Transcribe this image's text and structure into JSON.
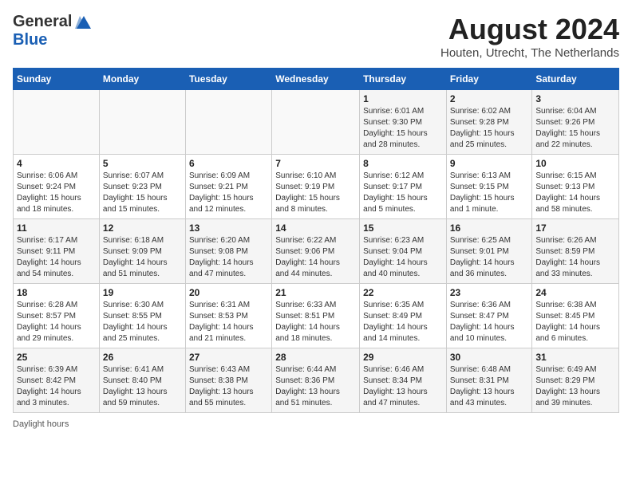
{
  "header": {
    "logo_general": "General",
    "logo_blue": "Blue",
    "month_year": "August 2024",
    "location": "Houten, Utrecht, The Netherlands"
  },
  "days_of_week": [
    "Sunday",
    "Monday",
    "Tuesday",
    "Wednesday",
    "Thursday",
    "Friday",
    "Saturday"
  ],
  "weeks": [
    [
      {
        "day": "",
        "info": ""
      },
      {
        "day": "",
        "info": ""
      },
      {
        "day": "",
        "info": ""
      },
      {
        "day": "",
        "info": ""
      },
      {
        "day": "1",
        "info": "Sunrise: 6:01 AM\nSunset: 9:30 PM\nDaylight: 15 hours\nand 28 minutes."
      },
      {
        "day": "2",
        "info": "Sunrise: 6:02 AM\nSunset: 9:28 PM\nDaylight: 15 hours\nand 25 minutes."
      },
      {
        "day": "3",
        "info": "Sunrise: 6:04 AM\nSunset: 9:26 PM\nDaylight: 15 hours\nand 22 minutes."
      }
    ],
    [
      {
        "day": "4",
        "info": "Sunrise: 6:06 AM\nSunset: 9:24 PM\nDaylight: 15 hours\nand 18 minutes."
      },
      {
        "day": "5",
        "info": "Sunrise: 6:07 AM\nSunset: 9:23 PM\nDaylight: 15 hours\nand 15 minutes."
      },
      {
        "day": "6",
        "info": "Sunrise: 6:09 AM\nSunset: 9:21 PM\nDaylight: 15 hours\nand 12 minutes."
      },
      {
        "day": "7",
        "info": "Sunrise: 6:10 AM\nSunset: 9:19 PM\nDaylight: 15 hours\nand 8 minutes."
      },
      {
        "day": "8",
        "info": "Sunrise: 6:12 AM\nSunset: 9:17 PM\nDaylight: 15 hours\nand 5 minutes."
      },
      {
        "day": "9",
        "info": "Sunrise: 6:13 AM\nSunset: 9:15 PM\nDaylight: 15 hours\nand 1 minute."
      },
      {
        "day": "10",
        "info": "Sunrise: 6:15 AM\nSunset: 9:13 PM\nDaylight: 14 hours\nand 58 minutes."
      }
    ],
    [
      {
        "day": "11",
        "info": "Sunrise: 6:17 AM\nSunset: 9:11 PM\nDaylight: 14 hours\nand 54 minutes."
      },
      {
        "day": "12",
        "info": "Sunrise: 6:18 AM\nSunset: 9:09 PM\nDaylight: 14 hours\nand 51 minutes."
      },
      {
        "day": "13",
        "info": "Sunrise: 6:20 AM\nSunset: 9:08 PM\nDaylight: 14 hours\nand 47 minutes."
      },
      {
        "day": "14",
        "info": "Sunrise: 6:22 AM\nSunset: 9:06 PM\nDaylight: 14 hours\nand 44 minutes."
      },
      {
        "day": "15",
        "info": "Sunrise: 6:23 AM\nSunset: 9:04 PM\nDaylight: 14 hours\nand 40 minutes."
      },
      {
        "day": "16",
        "info": "Sunrise: 6:25 AM\nSunset: 9:01 PM\nDaylight: 14 hours\nand 36 minutes."
      },
      {
        "day": "17",
        "info": "Sunrise: 6:26 AM\nSunset: 8:59 PM\nDaylight: 14 hours\nand 33 minutes."
      }
    ],
    [
      {
        "day": "18",
        "info": "Sunrise: 6:28 AM\nSunset: 8:57 PM\nDaylight: 14 hours\nand 29 minutes."
      },
      {
        "day": "19",
        "info": "Sunrise: 6:30 AM\nSunset: 8:55 PM\nDaylight: 14 hours\nand 25 minutes."
      },
      {
        "day": "20",
        "info": "Sunrise: 6:31 AM\nSunset: 8:53 PM\nDaylight: 14 hours\nand 21 minutes."
      },
      {
        "day": "21",
        "info": "Sunrise: 6:33 AM\nSunset: 8:51 PM\nDaylight: 14 hours\nand 18 minutes."
      },
      {
        "day": "22",
        "info": "Sunrise: 6:35 AM\nSunset: 8:49 PM\nDaylight: 14 hours\nand 14 minutes."
      },
      {
        "day": "23",
        "info": "Sunrise: 6:36 AM\nSunset: 8:47 PM\nDaylight: 14 hours\nand 10 minutes."
      },
      {
        "day": "24",
        "info": "Sunrise: 6:38 AM\nSunset: 8:45 PM\nDaylight: 14 hours\nand 6 minutes."
      }
    ],
    [
      {
        "day": "25",
        "info": "Sunrise: 6:39 AM\nSunset: 8:42 PM\nDaylight: 14 hours\nand 3 minutes."
      },
      {
        "day": "26",
        "info": "Sunrise: 6:41 AM\nSunset: 8:40 PM\nDaylight: 13 hours\nand 59 minutes."
      },
      {
        "day": "27",
        "info": "Sunrise: 6:43 AM\nSunset: 8:38 PM\nDaylight: 13 hours\nand 55 minutes."
      },
      {
        "day": "28",
        "info": "Sunrise: 6:44 AM\nSunset: 8:36 PM\nDaylight: 13 hours\nand 51 minutes."
      },
      {
        "day": "29",
        "info": "Sunrise: 6:46 AM\nSunset: 8:34 PM\nDaylight: 13 hours\nand 47 minutes."
      },
      {
        "day": "30",
        "info": "Sunrise: 6:48 AM\nSunset: 8:31 PM\nDaylight: 13 hours\nand 43 minutes."
      },
      {
        "day": "31",
        "info": "Sunrise: 6:49 AM\nSunset: 8:29 PM\nDaylight: 13 hours\nand 39 minutes."
      }
    ]
  ],
  "footer": {
    "note": "Daylight hours"
  }
}
